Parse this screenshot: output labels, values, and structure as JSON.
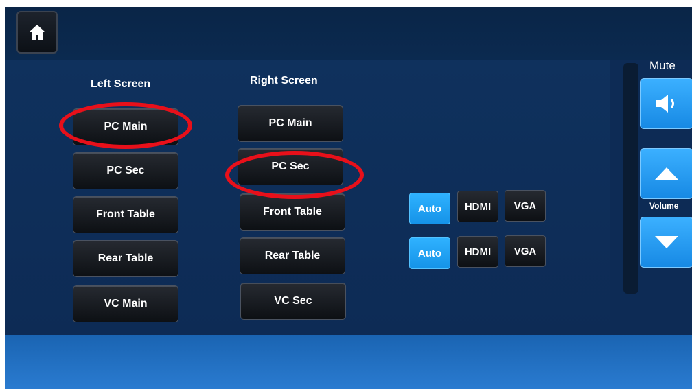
{
  "nav": {
    "home_icon": "home-icon"
  },
  "left_screen": {
    "heading": "Left Screen",
    "buttons": [
      "PC Main",
      "PC Sec",
      "Front Table",
      "Rear Table",
      "VC Main"
    ]
  },
  "right_screen": {
    "heading": "Right Screen",
    "buttons": [
      "PC Main",
      "PC Sec",
      "Front Table",
      "Rear Table",
      "VC Sec"
    ]
  },
  "input_modes": {
    "row1": [
      "Auto",
      "HDMI",
      "VGA"
    ],
    "row2": [
      "Auto",
      "HDMI",
      "VGA"
    ],
    "selected": "Auto"
  },
  "audio": {
    "mute_label": "Mute",
    "volume_label": "Volume",
    "mute_icon": "speaker-icon",
    "up_icon": "triangle-up-icon",
    "down_icon": "triangle-down-icon"
  },
  "colors": {
    "background": "#0d2b52",
    "accent": "#1e9cf0",
    "highlight_ring": "#e8101a"
  }
}
